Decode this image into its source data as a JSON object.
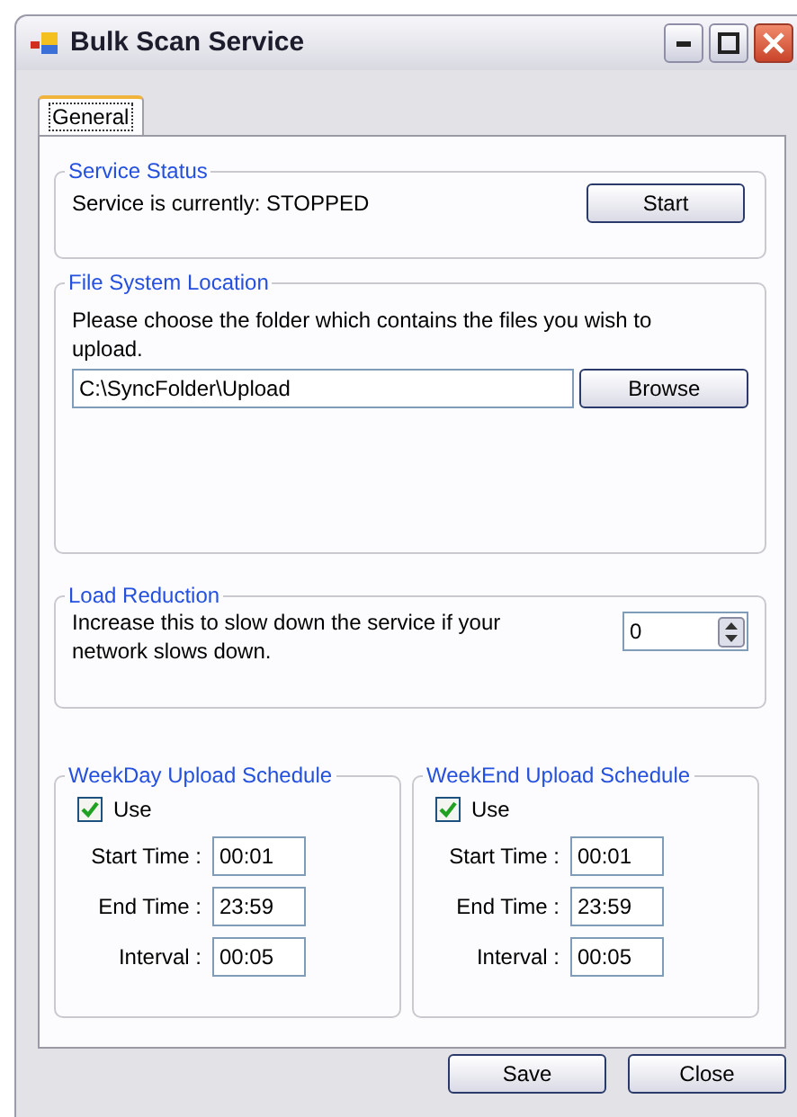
{
  "window": {
    "title": "Bulk Scan Service"
  },
  "tabs": [
    {
      "label": "General",
      "selected": true
    }
  ],
  "service_status": {
    "title": "Service Status",
    "text": "Service is currently: STOPPED",
    "button": "Start"
  },
  "file_system_location": {
    "title": "File System Location",
    "text": "Please choose the folder which contains the files you wish to upload.",
    "path": "C:\\SyncFolder\\Upload",
    "button": "Browse"
  },
  "load_reduction": {
    "title": "Load Reduction",
    "text": "Increase this to slow down the service if your network slows down.",
    "value": "0"
  },
  "schedules": [
    {
      "title": "WeekDay Upload Schedule",
      "use_label": "Use",
      "use_checked": true,
      "fields": [
        {
          "label": "Start Time :",
          "value": "00:01"
        },
        {
          "label": "End Time :",
          "value": "23:59"
        },
        {
          "label": "Interval :",
          "value": "00:05"
        }
      ]
    },
    {
      "title": "WeekEnd Upload Schedule",
      "use_label": "Use",
      "use_checked": true,
      "fields": [
        {
          "label": "Start Time :",
          "value": "00:01"
        },
        {
          "label": "End Time :",
          "value": "23:59"
        },
        {
          "label": "Interval :",
          "value": "00:05"
        }
      ]
    }
  ],
  "buttons": [
    "Save",
    "Close"
  ]
}
